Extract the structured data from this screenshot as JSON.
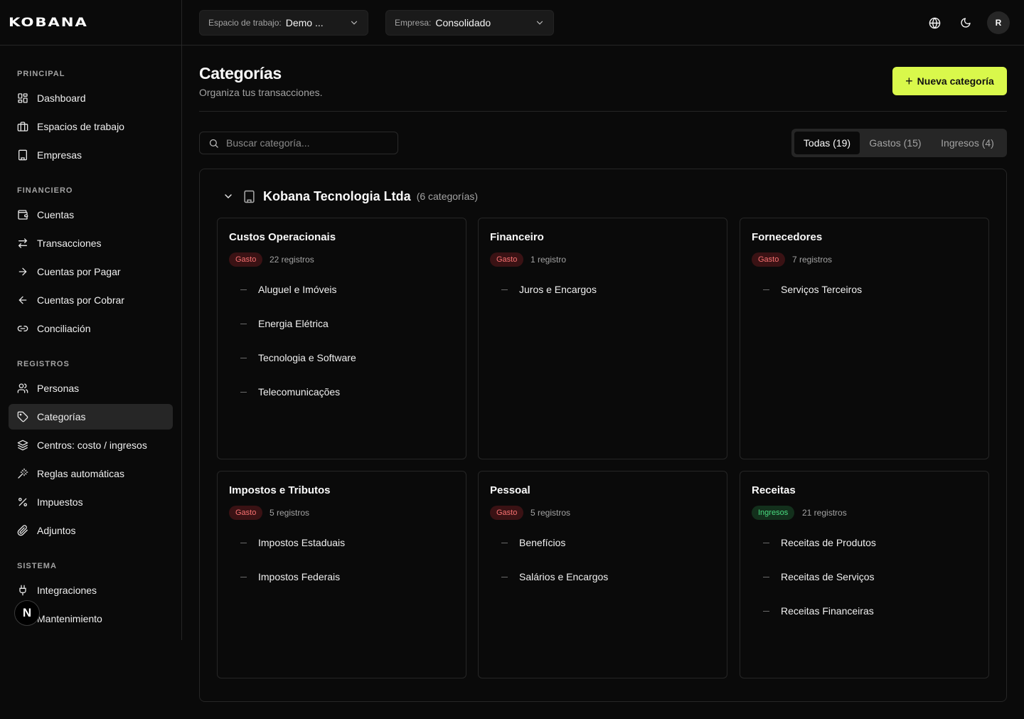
{
  "brand": {
    "logo_text": "KOBANA"
  },
  "topbar": {
    "workspace": {
      "label": "Espacio de trabajo:",
      "value": "Demo ..."
    },
    "company": {
      "label": "Empresa:",
      "value": "Consolidado"
    },
    "avatar_initial": "R"
  },
  "sidebar": {
    "sections": [
      {
        "title": "PRINCIPAL",
        "items": [
          {
            "label": "Dashboard",
            "icon": "dashboard-icon"
          },
          {
            "label": "Espacios de trabajo",
            "icon": "briefcase-icon"
          },
          {
            "label": "Empresas",
            "icon": "building-icon"
          }
        ]
      },
      {
        "title": "FINANCIERO",
        "items": [
          {
            "label": "Cuentas",
            "icon": "wallet-icon"
          },
          {
            "label": "Transacciones",
            "icon": "arrows-swap-icon"
          },
          {
            "label": "Cuentas por Pagar",
            "icon": "arrow-right-icon"
          },
          {
            "label": "Cuentas por Cobrar",
            "icon": "arrow-left-icon"
          },
          {
            "label": "Conciliación",
            "icon": "link-icon"
          }
        ]
      },
      {
        "title": "REGISTROS",
        "items": [
          {
            "label": "Personas",
            "icon": "users-icon"
          },
          {
            "label": "Categorías",
            "icon": "tag-icon",
            "active": true
          },
          {
            "label": "Centros: costo / ingresos",
            "icon": "layers-icon"
          },
          {
            "label": "Reglas automáticas",
            "icon": "wand-icon"
          },
          {
            "label": "Impuestos",
            "icon": "percent-icon"
          },
          {
            "label": "Adjuntos",
            "icon": "paperclip-icon"
          }
        ]
      },
      {
        "title": "SISTEMA",
        "items": [
          {
            "label": "Integraciones",
            "icon": "plug-icon"
          },
          {
            "label": "Mantenimiento",
            "icon": "wrench-icon"
          }
        ]
      }
    ],
    "next_badge": "N"
  },
  "page": {
    "title": "Categorías",
    "subtitle": "Organiza tus transacciones.",
    "new_button": "Nueva categoría",
    "search_placeholder": "Buscar categoría...",
    "tabs": [
      {
        "label": "Todas (19)",
        "active": true
      },
      {
        "label": "Gastos (15)"
      },
      {
        "label": "Ingresos (4)"
      }
    ]
  },
  "group": {
    "name": "Kobana Tecnologia Ltda",
    "count": "(6 categorías)",
    "cards": [
      {
        "title": "Custos Operacionais",
        "type": "Gasto",
        "kind": "gasto",
        "records": "22 registros",
        "subs": [
          "Aluguel e Imóveis",
          "Energia Elétrica",
          "Tecnologia e Software",
          "Telecomunicações"
        ]
      },
      {
        "title": "Financeiro",
        "type": "Gasto",
        "kind": "gasto",
        "records": "1 registro",
        "subs": [
          "Juros e Encargos"
        ]
      },
      {
        "title": "Fornecedores",
        "type": "Gasto",
        "kind": "gasto",
        "records": "7 registros",
        "subs": [
          "Serviços Terceiros"
        ]
      },
      {
        "title": "Impostos e Tributos",
        "type": "Gasto",
        "kind": "gasto",
        "records": "5 registros",
        "subs": [
          "Impostos Estaduais",
          "Impostos Federais"
        ]
      },
      {
        "title": "Pessoal",
        "type": "Gasto",
        "kind": "gasto",
        "records": "5 registros",
        "subs": [
          "Benefícios",
          "Salários e Encargos"
        ]
      },
      {
        "title": "Receitas",
        "type": "Ingresos",
        "kind": "ingreso",
        "records": "21 registros",
        "subs": [
          "Receitas de Produtos",
          "Receitas de Serviços",
          "Receitas Financeiras"
        ]
      }
    ]
  }
}
